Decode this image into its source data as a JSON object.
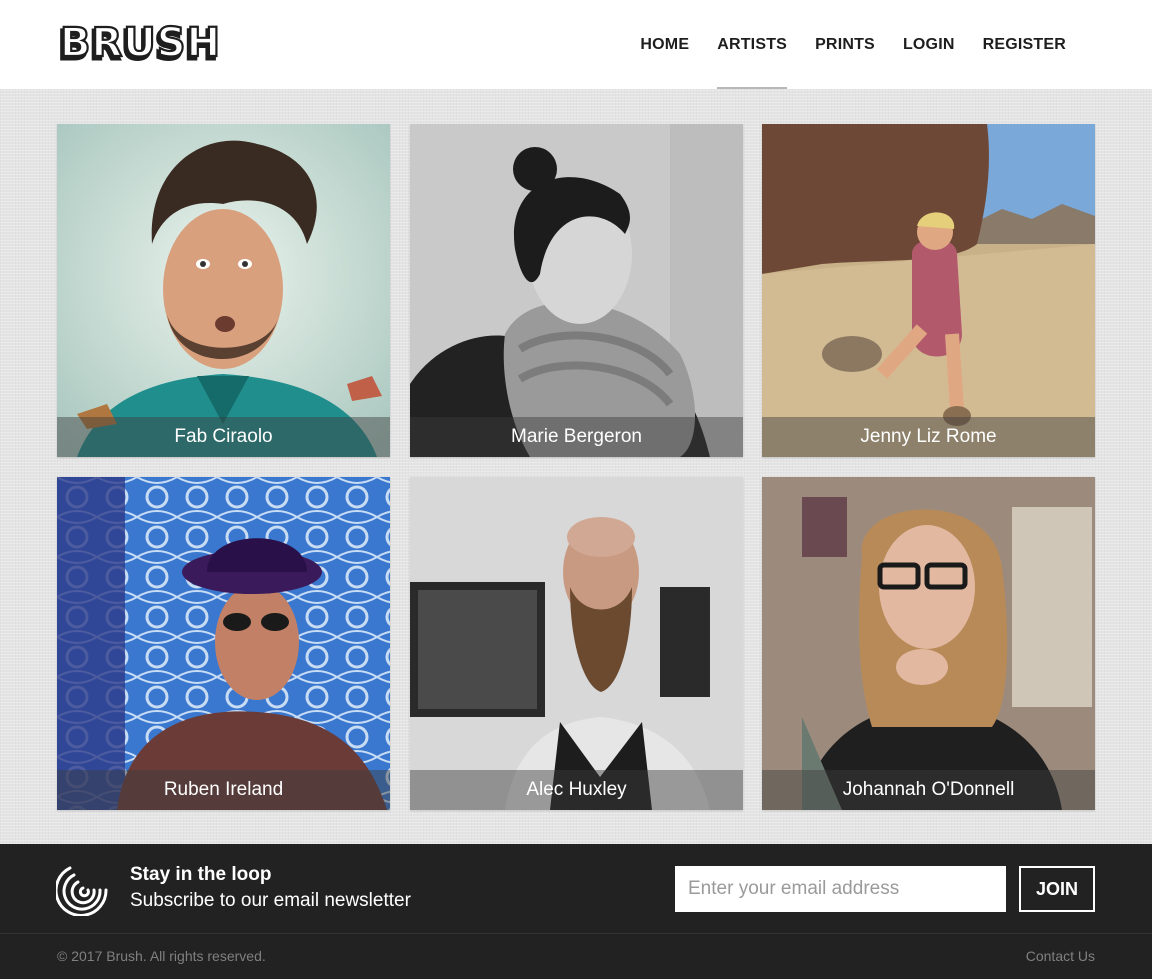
{
  "header": {
    "logo_text": "BRUSH",
    "nav": [
      {
        "label": "HOME",
        "active": false
      },
      {
        "label": "ARTISTS",
        "active": true
      },
      {
        "label": "PRINTS",
        "active": false
      },
      {
        "label": "LOGIN",
        "active": false
      },
      {
        "label": "REGISTER",
        "active": false
      }
    ]
  },
  "artists": [
    {
      "name": "Fab Ciraolo"
    },
    {
      "name": "Marie Bergeron"
    },
    {
      "name": "Jenny Liz Rome"
    },
    {
      "name": "Ruben Ireland"
    },
    {
      "name": "Alec Huxley"
    },
    {
      "name": "Johannah O'Donnell"
    }
  ],
  "newsletter": {
    "icon": "loop-icon",
    "title": "Stay in the loop",
    "subtitle": "Subscribe to our email newsletter",
    "email_placeholder": "Enter your email address",
    "email_value": "",
    "join_label": "JOIN"
  },
  "footer": {
    "copyright": "© 2017 Brush. All rights reserved.",
    "contact_label": "Contact Us"
  },
  "colors": {
    "header_bg": "#ffffff",
    "page_bg": "#e4e4e4",
    "footer_bg": "#222222",
    "text_dark": "#1e1e1e",
    "footer_text_muted": "#808080"
  }
}
